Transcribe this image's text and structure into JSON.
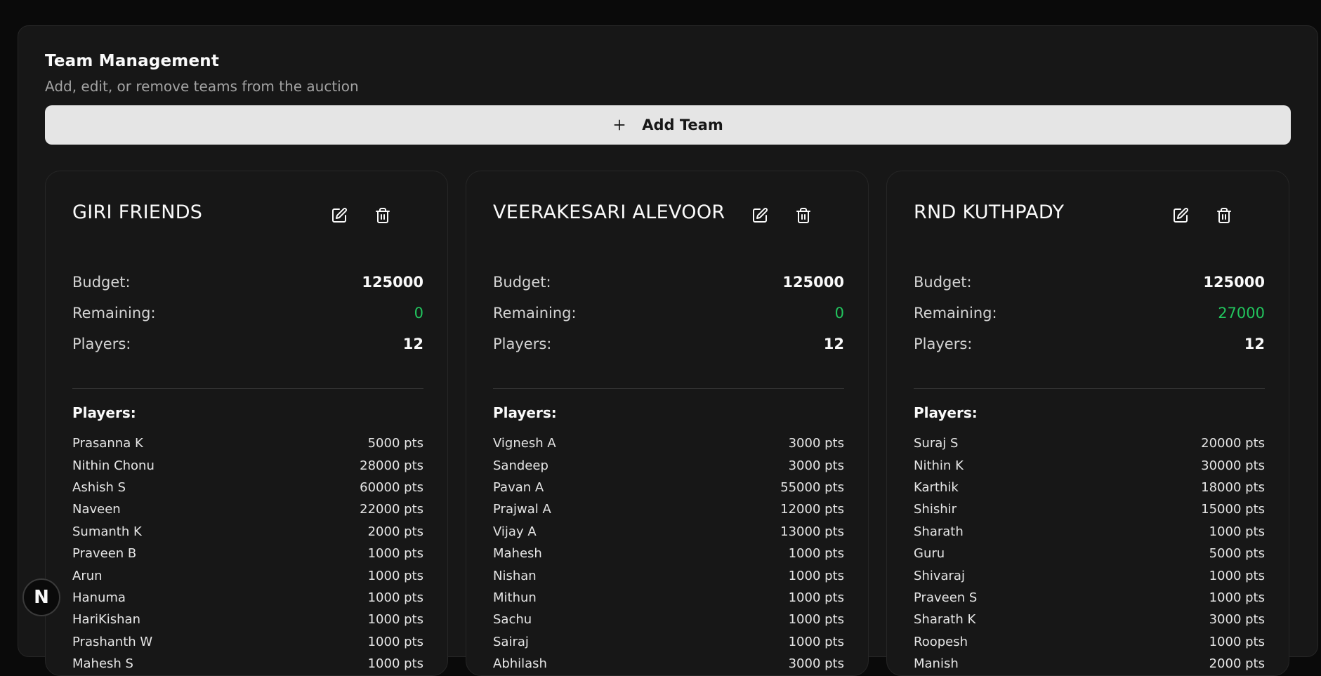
{
  "header": {
    "title": "Team Management",
    "subtitle": "Add, edit, or remove teams from the auction",
    "add_button_label": "Add Team"
  },
  "labels": {
    "budget": "Budget:",
    "remaining": "Remaining:",
    "players": "Players:",
    "players_heading": "Players:"
  },
  "icons": {
    "add": "plus-icon",
    "edit": "edit-icon",
    "delete": "trash-icon",
    "dev_badge": "N"
  },
  "colors": {
    "remaining_value": "#22c55e",
    "button_bg": "#e5e5e5",
    "panel_bg": "#171717"
  },
  "teams": [
    {
      "name": "GIRI FRIENDS",
      "budget": "125000",
      "remaining": "0",
      "players_count": "12",
      "players": [
        {
          "name": "Prasanna K",
          "pts": "5000 pts"
        },
        {
          "name": "Nithin Chonu",
          "pts": "28000 pts"
        },
        {
          "name": "Ashish S",
          "pts": "60000 pts"
        },
        {
          "name": "Naveen",
          "pts": "22000 pts"
        },
        {
          "name": "Sumanth K",
          "pts": "2000 pts"
        },
        {
          "name": "Praveen B",
          "pts": "1000 pts"
        },
        {
          "name": "Arun",
          "pts": "1000 pts"
        },
        {
          "name": "Hanuma",
          "pts": "1000 pts"
        },
        {
          "name": "HariKishan",
          "pts": "1000 pts"
        },
        {
          "name": "Prashanth W",
          "pts": "1000 pts"
        },
        {
          "name": "Mahesh S",
          "pts": "1000 pts"
        }
      ]
    },
    {
      "name": "VEERAKESARI ALEVOOR",
      "budget": "125000",
      "remaining": "0",
      "players_count": "12",
      "players": [
        {
          "name": "Vignesh A",
          "pts": "3000 pts"
        },
        {
          "name": "Sandeep",
          "pts": "3000 pts"
        },
        {
          "name": "Pavan A",
          "pts": "55000 pts"
        },
        {
          "name": "Prajwal A",
          "pts": "12000 pts"
        },
        {
          "name": "Vijay A",
          "pts": "13000 pts"
        },
        {
          "name": "Mahesh",
          "pts": "1000 pts"
        },
        {
          "name": "Nishan",
          "pts": "1000 pts"
        },
        {
          "name": "Mithun",
          "pts": "1000 pts"
        },
        {
          "name": "Sachu",
          "pts": "1000 pts"
        },
        {
          "name": "Sairaj",
          "pts": "1000 pts"
        },
        {
          "name": "Abhilash",
          "pts": "3000 pts"
        }
      ]
    },
    {
      "name": "RND KUTHPADY",
      "budget": "125000",
      "remaining": "27000",
      "players_count": "12",
      "players": [
        {
          "name": "Suraj S",
          "pts": "20000 pts"
        },
        {
          "name": "Nithin K",
          "pts": "30000 pts"
        },
        {
          "name": "Karthik",
          "pts": "18000 pts"
        },
        {
          "name": "Shishir",
          "pts": "15000 pts"
        },
        {
          "name": "Sharath",
          "pts": "1000 pts"
        },
        {
          "name": "Guru",
          "pts": "5000 pts"
        },
        {
          "name": "Shivaraj",
          "pts": "1000 pts"
        },
        {
          "name": "Praveen S",
          "pts": "1000 pts"
        },
        {
          "name": "Sharath K",
          "pts": "3000 pts"
        },
        {
          "name": "Roopesh",
          "pts": "1000 pts"
        },
        {
          "name": "Manish",
          "pts": "2000 pts"
        }
      ]
    }
  ]
}
